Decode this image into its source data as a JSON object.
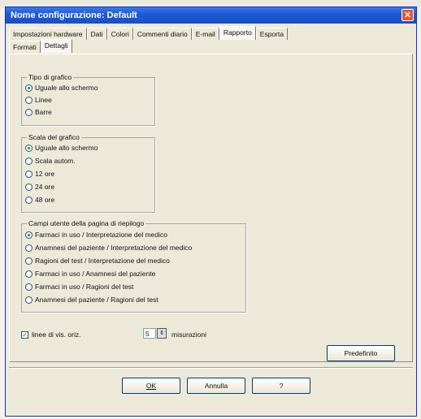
{
  "window": {
    "title": "Nome configurazione: Default",
    "close_label": "✕"
  },
  "tabs_row1": [
    "Impostazioni hardware",
    "Dati",
    "Colori",
    "Commenti diario",
    "E-mail",
    "Rapporto",
    "Esporta"
  ],
  "tabs_row1_active": "Rapporto",
  "tabs_row2": [
    "Formati",
    "Dettagli"
  ],
  "tabs_row2_active": "Dettagli",
  "tipo_grafico": {
    "label": "Tipo di grafico",
    "options": [
      "Uguale allo schermo",
      "Linee",
      "Barre"
    ],
    "selected": "Uguale allo schermo"
  },
  "scala_grafico": {
    "label": "Scala del grafico",
    "options": [
      "Uguale allo schermo",
      "Scala autom.",
      "12 ore",
      "24 ore",
      "48 ore"
    ],
    "selected": "Uguale allo schermo"
  },
  "campi_utente": {
    "label": "Campi utente della pagina di riepilogo",
    "options": [
      "Farmaci in uso / Interpretazione del medico",
      "Anamnesi del paziente / Interpretazione del medico",
      "Ragioni del test / Interpretazione del medico",
      "Farmaci in uso / Anamnesi del paziente",
      "Farmaci in uso  / Ragioni del test",
      "Anamnesi del paziente / Ragioni del test"
    ],
    "selected": "Farmaci in uso / Interpretazione del medico"
  },
  "linee_checkbox": {
    "label": "linee di vis. oriz.",
    "checked": true
  },
  "misurazioni": {
    "value": "5",
    "label": "misurazioni"
  },
  "buttons": {
    "predefinito": "Predefinito",
    "ok": "OK",
    "annulla": "Annulla",
    "help": "?"
  }
}
